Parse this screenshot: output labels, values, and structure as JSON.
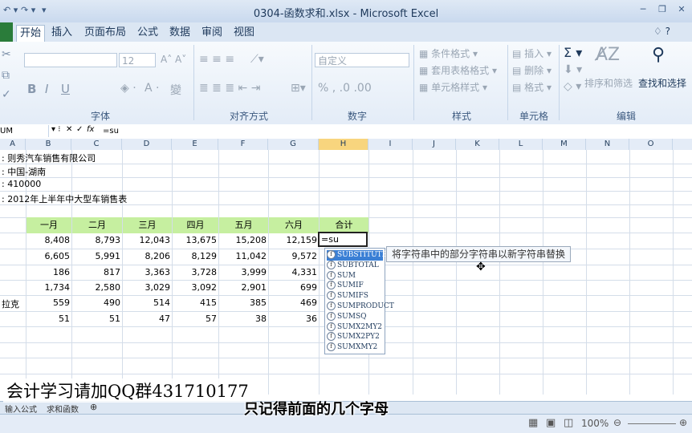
{
  "window": {
    "title": "0304-函数求和.xlsx - Microsoft Excel"
  },
  "ribbon_tabs": [
    "开始",
    "插入",
    "页面布局",
    "公式",
    "数据",
    "审阅",
    "视图"
  ],
  "ribbon": {
    "font_group": "字体",
    "font_size": "12",
    "align_group": "对齐方式",
    "number_group": "数字",
    "number_format": "自定义",
    "style_group": "样式",
    "conditional_format": "条件格式",
    "table_format": "套用表格格式",
    "cell_style": "单元格样式",
    "cells_group": "单元格",
    "insert": "插入",
    "delete": "删除",
    "format": "格式",
    "edit_group": "编辑",
    "sort_filter": "排序和筛选",
    "find_select": "查找和选择"
  },
  "formula_bar": {
    "name_box": "UM",
    "formula": "=su"
  },
  "columns": [
    "A",
    "B",
    "C",
    "D",
    "E",
    "F",
    "G",
    "H",
    "I",
    "J",
    "K",
    "L",
    "M",
    "N",
    "O"
  ],
  "info_lines": [
    ": 则秀汽车销售有限公司",
    ": 中国-湖南",
    ": 410000",
    ": 2012年上半年中大型车销售表"
  ],
  "table": {
    "headers": [
      "一月",
      "二月",
      "三月",
      "四月",
      "五月",
      "六月",
      "合计"
    ],
    "rows": [
      {
        "label": "",
        "values": [
          "8,408",
          "8,793",
          "12,043",
          "13,675",
          "15,208",
          "12,159"
        ]
      },
      {
        "label": "",
        "values": [
          "6,605",
          "5,991",
          "8,206",
          "8,129",
          "11,042",
          "9,572"
        ]
      },
      {
        "label": "",
        "values": [
          "186",
          "817",
          "3,363",
          "3,728",
          "3,999",
          "4,331"
        ]
      },
      {
        "label": "",
        "values": [
          "1,734",
          "2,580",
          "3,029",
          "3,092",
          "2,901",
          "699"
        ]
      },
      {
        "label": "拉克",
        "values": [
          "559",
          "490",
          "514",
          "415",
          "385",
          "469"
        ]
      },
      {
        "label": "",
        "values": [
          "51",
          "51",
          "47",
          "57",
          "38",
          "36"
        ]
      }
    ],
    "editing_cell": "=su"
  },
  "autocomplete": {
    "items": [
      "SUBSTITUTE",
      "SUBTOTAL",
      "SUM",
      "SUMIF",
      "SUMIFS",
      "SUMPRODUCT",
      "SUMSQ",
      "SUMX2MY2",
      "SUMX2PY2",
      "SUMXMY2"
    ],
    "tooltip": "将字符串中的部分字符串以新字符串替换"
  },
  "sheet_tabs": [
    "输入公式",
    "求和函数"
  ],
  "status": {
    "zoom": "100%"
  },
  "overlay": {
    "watermark": "会计学习请加QQ群431710177",
    "subtitle": "只记得前面的几个字母"
  }
}
